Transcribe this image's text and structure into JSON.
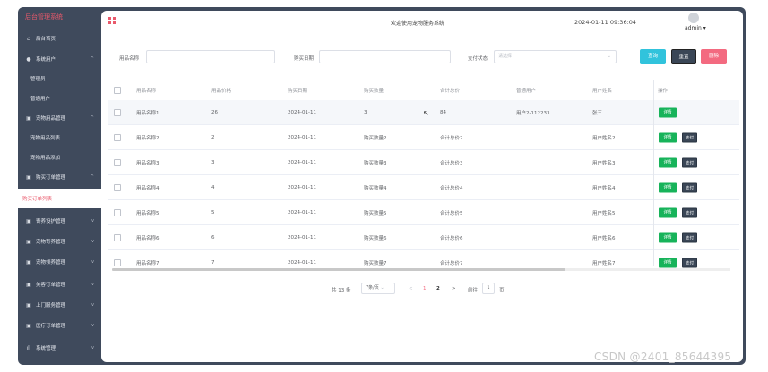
{
  "sidebar": {
    "brand": "后台管理系统",
    "items": [
      {
        "label": "后台首页",
        "icon": "home-icon",
        "arrow": ""
      },
      {
        "label": "系统用户",
        "icon": "user-icon",
        "arrow": "^"
      },
      {
        "label": "管理员",
        "sub": true
      },
      {
        "label": "普通用户",
        "sub": true
      },
      {
        "label": "宠物用品管理",
        "icon": "box-icon",
        "arrow": "^"
      },
      {
        "label": "宠物用品列表",
        "sub": true
      },
      {
        "label": "宠物用品添加",
        "sub": true
      },
      {
        "label": "购买订单管理",
        "icon": "box-icon",
        "arrow": "^"
      },
      {
        "label": "购买订单列表",
        "sub": true,
        "active": true
      },
      {
        "label": "寄养设护管理",
        "icon": "box-icon",
        "arrow": "v"
      },
      {
        "label": "宠物寄养管理",
        "icon": "box-icon",
        "arrow": "v"
      },
      {
        "label": "宠物领养管理",
        "icon": "box-icon",
        "arrow": "v"
      },
      {
        "label": "美容订单管理",
        "icon": "box-icon",
        "arrow": "v"
      },
      {
        "label": "上门服务管理",
        "icon": "box-icon",
        "arrow": "v"
      },
      {
        "label": "医疗订单管理",
        "icon": "box-icon",
        "arrow": "v"
      },
      {
        "label": "系统管理",
        "icon": "chart-icon",
        "arrow": "v"
      }
    ]
  },
  "header": {
    "welcome": "欢迎使用宠物服务系统",
    "datetime": "2024-01-11 09:36:04",
    "user": "admin ▾"
  },
  "filters": {
    "name_label": "用品名称",
    "date_label": "购买日期",
    "status_label": "支付状态",
    "status_placeholder": "请选择",
    "query_label": "查询",
    "reset_label": "重置",
    "delete_label": "删除"
  },
  "table": {
    "headers": [
      "用品名称",
      "用品价格",
      "购买日期",
      "购买数量",
      "合计总价",
      "普通用户",
      "用户姓名",
      "操作"
    ],
    "rows": [
      {
        "name": "用品名称1",
        "price": "26",
        "date": "2024-01-11",
        "qty": "3",
        "total": "84",
        "user": "用户2-112233",
        "uname": "张三",
        "pay": false
      },
      {
        "name": "用品名称2",
        "price": "2",
        "date": "2024-01-11",
        "qty": "购买数量2",
        "total": "合计总价2",
        "user": "",
        "uname": "用户姓名2",
        "pay": true
      },
      {
        "name": "用品名称3",
        "price": "3",
        "date": "2024-01-11",
        "qty": "购买数量3",
        "total": "合计总价3",
        "user": "",
        "uname": "用户姓名3",
        "pay": true
      },
      {
        "name": "用品名称4",
        "price": "4",
        "date": "2024-01-11",
        "qty": "购买数量4",
        "total": "合计总价4",
        "user": "",
        "uname": "用户姓名4",
        "pay": true
      },
      {
        "name": "用品名称5",
        "price": "5",
        "date": "2024-01-11",
        "qty": "购买数量5",
        "total": "合计总价5",
        "user": "",
        "uname": "用户姓名5",
        "pay": true
      },
      {
        "name": "用品名称6",
        "price": "6",
        "date": "2024-01-11",
        "qty": "购买数量6",
        "total": "合计总价6",
        "user": "",
        "uname": "用户姓名6",
        "pay": true
      },
      {
        "name": "用品名称7",
        "price": "7",
        "date": "2024-01-11",
        "qty": "购买数量7",
        "total": "合计总价7",
        "user": "",
        "uname": "用户姓名7",
        "pay": true
      }
    ],
    "detail_label": "详情",
    "pay_label": "支付"
  },
  "pagination": {
    "total": "共 13 条",
    "page_size": "7条/页",
    "prev": "<",
    "page1": "1",
    "page2": "2",
    "next": ">",
    "goto": "前往",
    "goto_value": "1",
    "page_unit": "页"
  },
  "watermark": "CSDN @2401_85644395",
  "colors": {
    "sidebar_bg": "#3f4a5c",
    "accent": "#e9596b",
    "query_btn": "#31c3dc",
    "reset_btn": "#3a4656",
    "delete_btn": "#f36a80",
    "detail_btn": "#17b35a"
  }
}
